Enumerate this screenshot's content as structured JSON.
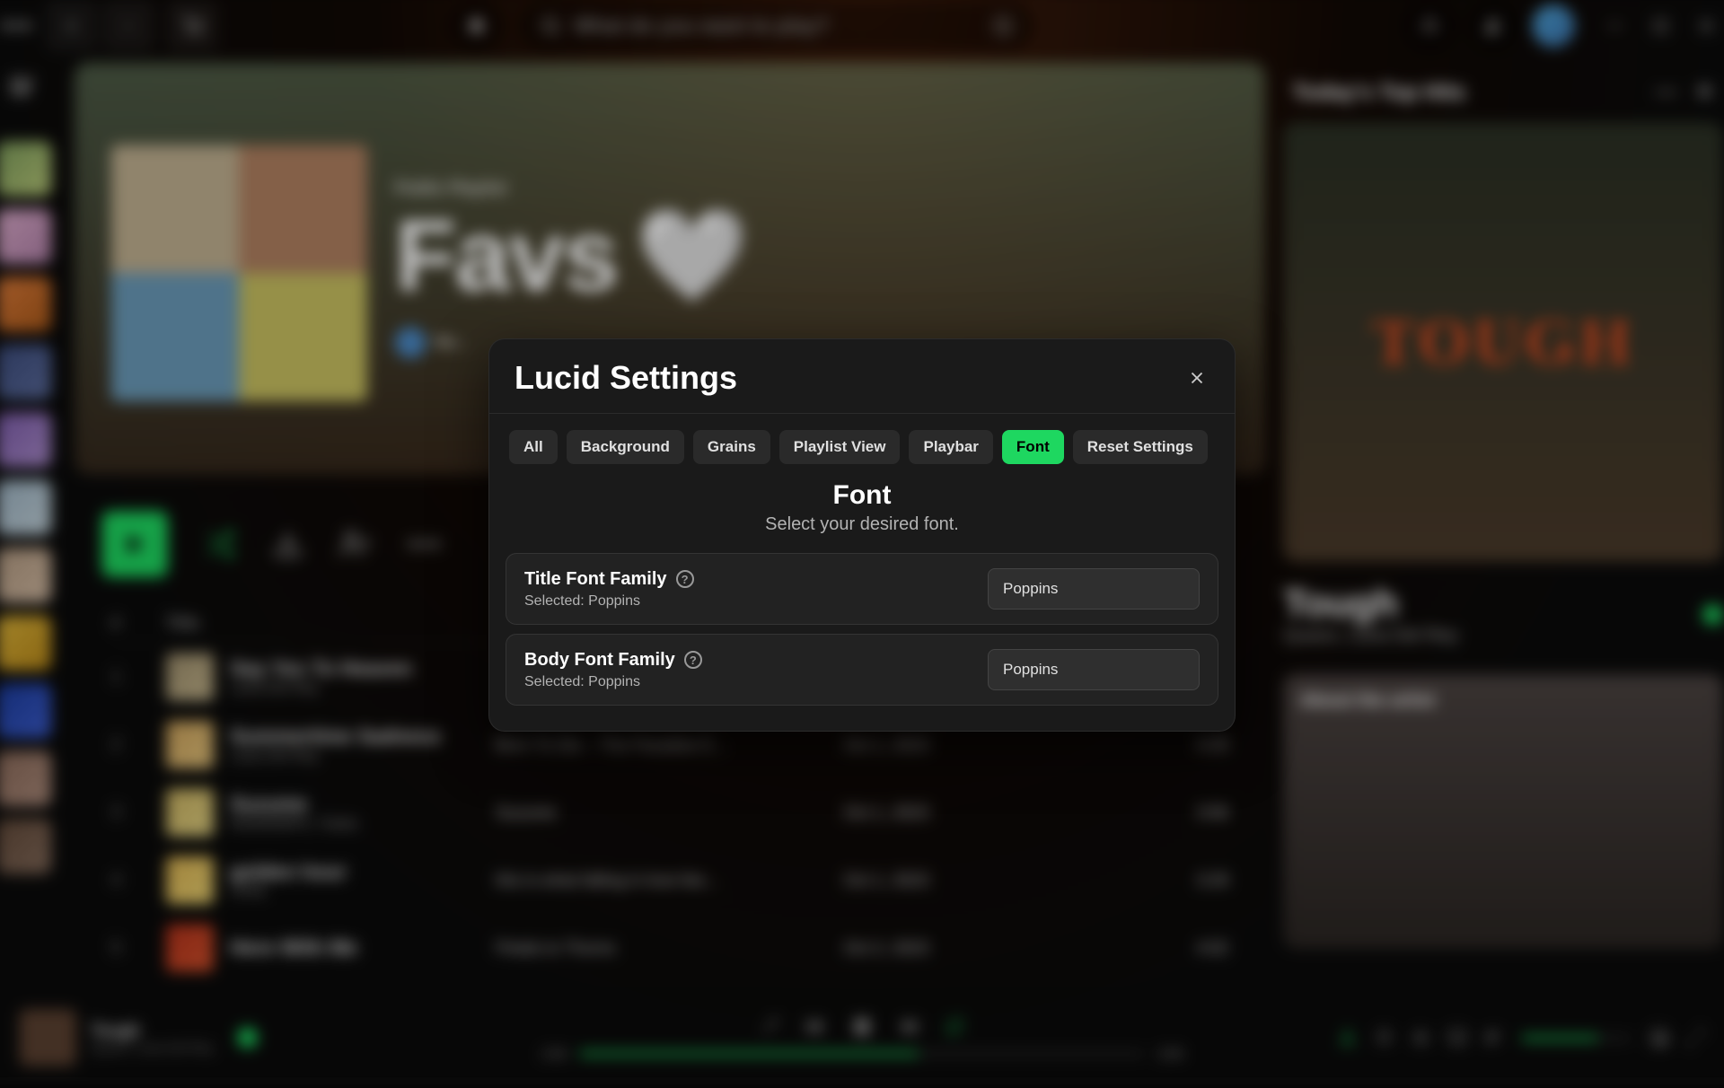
{
  "titlebar": {
    "search_placeholder": "What do you want to play?"
  },
  "hero": {
    "label": "Public Playlist",
    "title": "Favs",
    "owner": "So..."
  },
  "columns": {
    "num": "#",
    "title": "Title"
  },
  "tracks": [
    {
      "n": "1",
      "name": "Say Yes To Heaven",
      "artist": "Lana Del Rey",
      "album": "",
      "date": "",
      "dur": "",
      "c1": "#9a8b6a",
      "c2": "#c2b38a"
    },
    {
      "n": "2",
      "name": "Summertime Sadness",
      "artist": "Lana Del Rey",
      "album": "Born To Die – The Paradise E...",
      "date": "Oct 1, 2023",
      "dur": "4:25",
      "c1": "#caa05a",
      "c2": "#e2c27a"
    },
    {
      "n": "3",
      "name": "Suzume",
      "artist": "RADWIMPS, Toaka",
      "album": "Suzume",
      "date": "Oct 1, 2023",
      "dur": "3:56",
      "c1": "#c8b060",
      "c2": "#e0d080"
    },
    {
      "n": "4",
      "name": "golden hour",
      "artist": "JVKE",
      "album": "this is what falling in love fee...",
      "date": "Oct 1, 2023",
      "dur": "3:29",
      "c1": "#d8b050",
      "c2": "#e8d070"
    },
    {
      "n": "5",
      "name": "Here With Me",
      "artist": "",
      "album": "Petals to Thorns",
      "date": "Oct 2, 2023",
      "dur": "4:02",
      "c1": "#b0301a",
      "c2": "#d0502a"
    }
  ],
  "right": {
    "heading": "Today's Top Hits",
    "cover_title": "TOUGH",
    "now_title": "Tough",
    "now_artist": "Quavo, Lana Del Rey",
    "about": "About the artist"
  },
  "playbar": {
    "title": "Tough",
    "artist": "Quavo, Lana Del Rey",
    "elapsed": "2:06",
    "total": "3:08"
  },
  "modal": {
    "title": "Lucid Settings",
    "tabs": [
      "All",
      "Background",
      "Grains",
      "Playlist View",
      "Playbar",
      "Font",
      "Reset Settings"
    ],
    "active_tab": "Font",
    "section_title": "Font",
    "section_sub": "Select your desired font.",
    "options": [
      {
        "label": "Title Font Family",
        "selected_prefix": "Selected: ",
        "selected": "Poppins",
        "value": "Poppins"
      },
      {
        "label": "Body Font Family",
        "selected_prefix": "Selected: ",
        "selected": "Poppins",
        "value": "Poppins"
      }
    ]
  },
  "rail_colors": [
    [
      "#7a9a5a",
      "#b8c878"
    ],
    [
      "#d8a8c8",
      "#b080a8"
    ],
    [
      "#d87838",
      "#a85818"
    ],
    [
      "#3a4a7a",
      "#5a6a9a"
    ],
    [
      "#7a5aa8",
      "#a88ac8"
    ],
    [
      "#9ab0c0",
      "#c0d0d8"
    ],
    [
      "#b09880",
      "#d0b8a0"
    ],
    [
      "#d8b038",
      "#b88818"
    ],
    [
      "#1a3a9a",
      "#3a5ac8"
    ],
    [
      "#886858",
      "#a88878"
    ],
    [
      "#604838",
      "#806858"
    ]
  ],
  "hero_quad": [
    "#c0b090",
    "#b08060",
    "#6a9ab8",
    "#c8c060"
  ]
}
